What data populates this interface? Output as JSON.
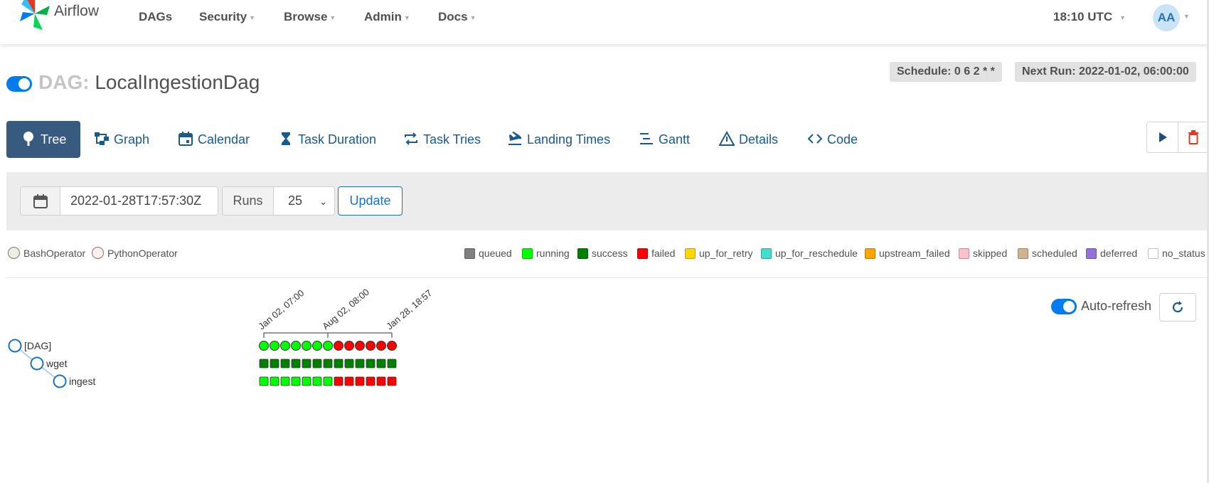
{
  "navbar": {
    "brand": "Airflow",
    "menu": [
      {
        "label": "DAGs",
        "dropdown": false
      },
      {
        "label": "Security",
        "dropdown": true
      },
      {
        "label": "Browse",
        "dropdown": true
      },
      {
        "label": "Admin",
        "dropdown": true
      },
      {
        "label": "Docs",
        "dropdown": true
      }
    ],
    "clock": "18:10 UTC",
    "user_initials": "AA"
  },
  "dag": {
    "prefix": "DAG:",
    "name": "LocalIngestionDag",
    "paused": false,
    "schedule": "Schedule: 0 6 2 * *",
    "next_run": "Next Run: 2022-01-02, 06:00:00"
  },
  "tabs": [
    {
      "label": "Tree",
      "icon": "tree-icon",
      "active": true
    },
    {
      "label": "Graph",
      "icon": "graph-icon",
      "active": false
    },
    {
      "label": "Calendar",
      "icon": "calendar-icon",
      "active": false
    },
    {
      "label": "Task Duration",
      "icon": "hourglass-icon",
      "active": false
    },
    {
      "label": "Task Tries",
      "icon": "retry-icon",
      "active": false
    },
    {
      "label": "Landing Times",
      "icon": "plane-landing-icon",
      "active": false
    },
    {
      "label": "Gantt",
      "icon": "gantt-icon",
      "active": false
    },
    {
      "label": "Details",
      "icon": "warning-triangle-icon",
      "active": false
    },
    {
      "label": "Code",
      "icon": "code-icon",
      "active": false
    }
  ],
  "controls": {
    "base_date": "2022-01-28T17:57:30Z",
    "runs_label": "Runs",
    "runs_value": "25",
    "update_label": "Update"
  },
  "operators": [
    {
      "label": "BashOperator",
      "color": "#f0ede4"
    },
    {
      "label": "PythonOperator",
      "color": "#ffefeb"
    }
  ],
  "states": [
    {
      "label": "queued",
      "color": "#808080"
    },
    {
      "label": "running",
      "color": "#00ff00"
    },
    {
      "label": "success",
      "color": "#008000"
    },
    {
      "label": "failed",
      "color": "#ff0000"
    },
    {
      "label": "up_for_retry",
      "color": "#ffd700"
    },
    {
      "label": "up_for_reschedule",
      "color": "#40e0d0"
    },
    {
      "label": "upstream_failed",
      "color": "#ffa500"
    },
    {
      "label": "skipped",
      "color": "#ffc0cb"
    },
    {
      "label": "scheduled",
      "color": "#d2b48c"
    },
    {
      "label": "deferred",
      "color": "#9370db"
    },
    {
      "label": "no_status",
      "color": "#ffffff"
    }
  ],
  "auto_refresh": {
    "label": "Auto-refresh",
    "enabled": true
  },
  "tree": {
    "nodes": [
      {
        "label": "[DAG]",
        "depth": 0
      },
      {
        "label": "wget",
        "depth": 1
      },
      {
        "label": "ingest",
        "depth": 2
      }
    ],
    "date_labels": [
      "Jan 02, 07:00",
      "Aug 02, 08:00",
      "Jan 28, 18:57"
    ],
    "dag_runs": [
      "running",
      "running",
      "running",
      "running",
      "running",
      "running",
      "running",
      "failed",
      "failed",
      "failed",
      "failed",
      "failed",
      "failed"
    ],
    "wget": [
      "success",
      "success",
      "success",
      "success",
      "success",
      "success",
      "success",
      "success",
      "success",
      "success",
      "success",
      "success",
      "success"
    ],
    "ingest": [
      "running",
      "running",
      "running",
      "running",
      "running",
      "running",
      "running",
      "failed",
      "failed",
      "failed",
      "failed",
      "failed",
      "failed"
    ]
  }
}
